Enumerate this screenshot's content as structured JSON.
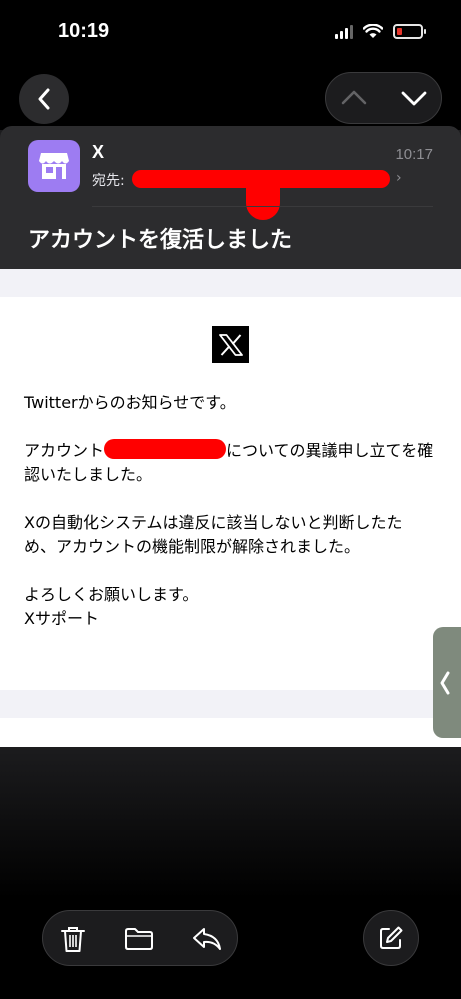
{
  "status_bar": {
    "time": "10:19"
  },
  "mail": {
    "sender": "X",
    "to_label": "宛先:",
    "time": "10:17",
    "subject": "アカウントを復活しました"
  },
  "body": {
    "logo_letter": "𝕏",
    "p1": "Twitterからのお知らせです。",
    "p2_before": "アカウント",
    "p2_after": "についての異議申し立てを確認いたしました。",
    "p3": "Xの自動化システムは違反に該当しないと判断したため、アカウントの機能制限が解除されました。",
    "p4_line1": "よろしくお願いします。",
    "p4_line2": "Xサポート"
  },
  "colors": {
    "redaction": "#ff0000",
    "avatar": "#9d7cf2",
    "battery_low": "#ff3b30"
  },
  "icons": {
    "back": "chevron-left-icon",
    "prev": "chevron-up-icon",
    "next": "chevron-down-icon",
    "avatar": "storefront-icon",
    "trash": "trash-icon",
    "folder": "folder-icon",
    "reply": "reply-icon",
    "compose": "compose-icon"
  }
}
